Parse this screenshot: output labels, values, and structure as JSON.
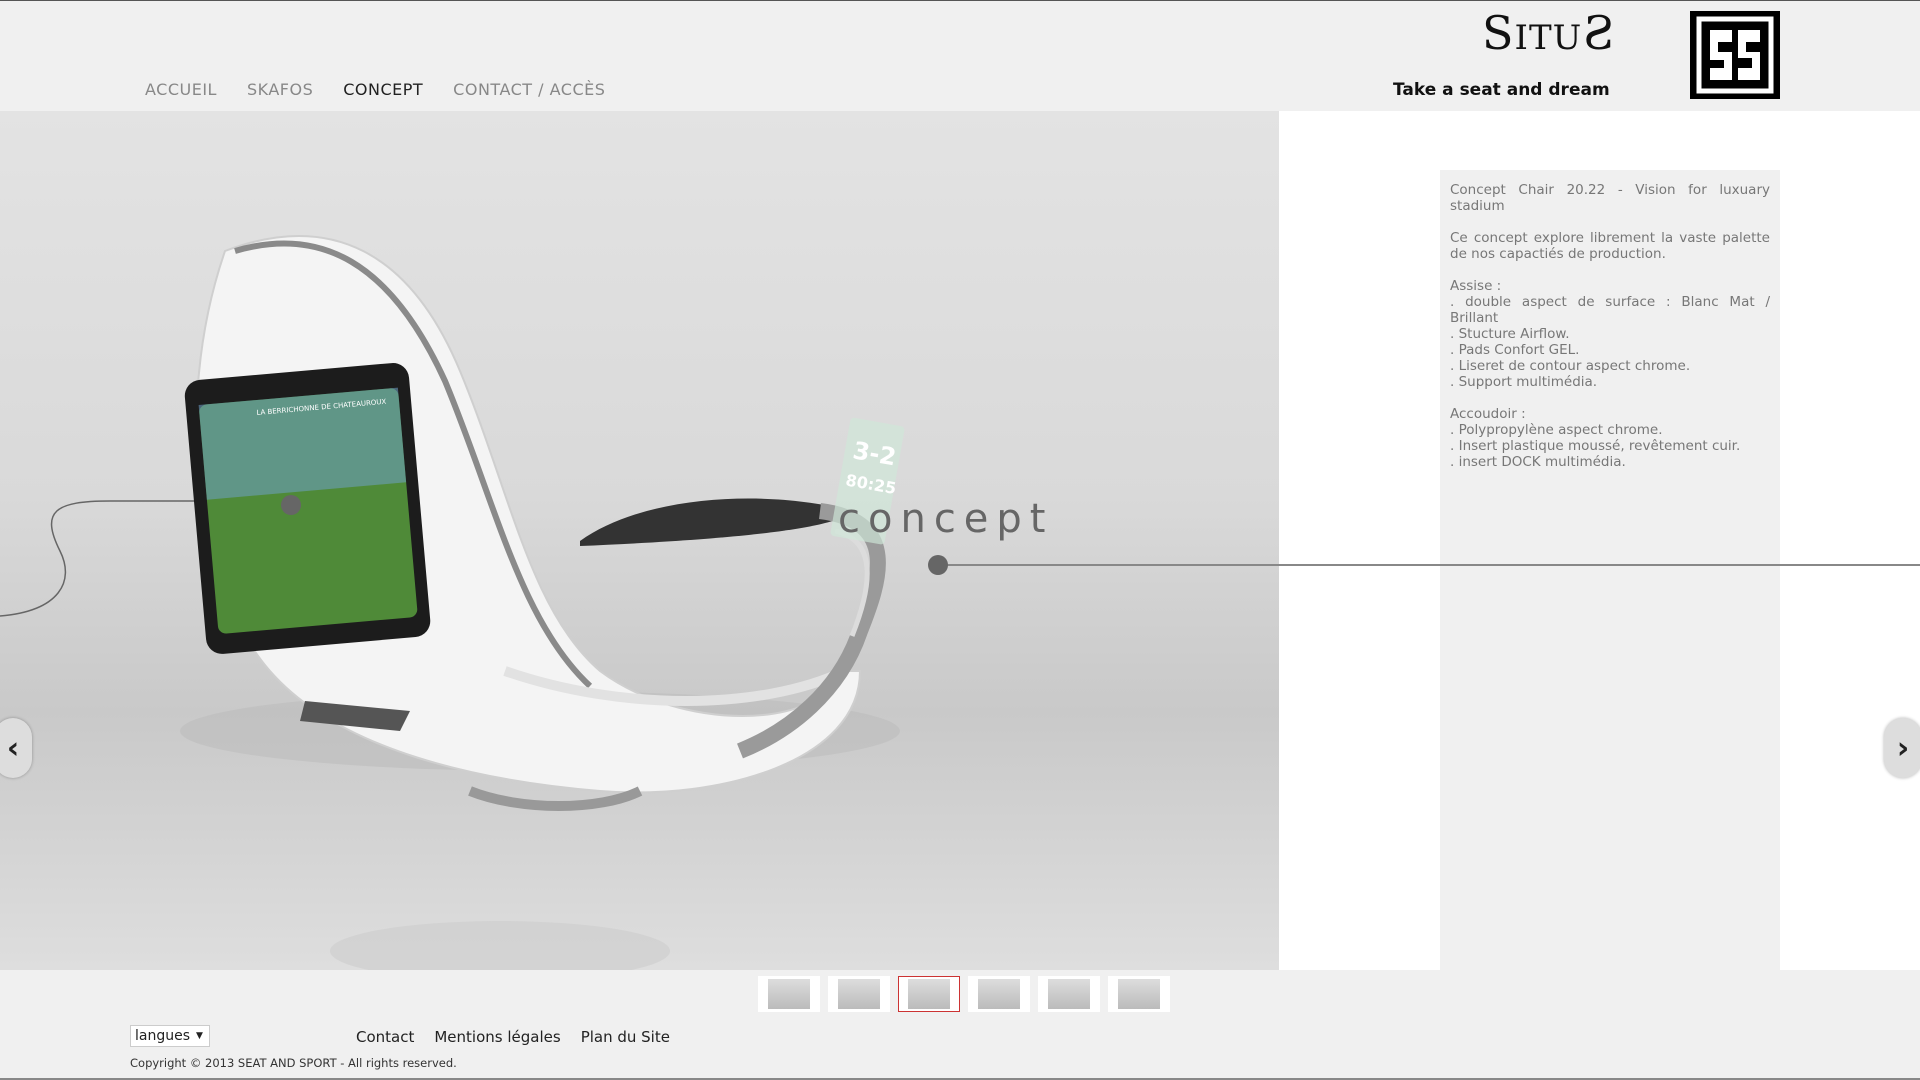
{
  "nav": {
    "items": [
      {
        "label": "ACCUEIL",
        "active": false
      },
      {
        "label": "SKAFOS",
        "active": false
      },
      {
        "label": "CONCEPT",
        "active": true
      },
      {
        "label": "CONTACT / ACCÈS",
        "active": false
      }
    ]
  },
  "brand": {
    "logo_text_first": "S",
    "logo_text_middle": "ITU",
    "logo_text_last": "S",
    "tagline": "Take a seat and dream"
  },
  "slide": {
    "overlay_word": "concept",
    "tablet_title": "LA BERRICHONNE DE CHATEAUROUX",
    "dock_score": "3-2",
    "dock_time": "80:25"
  },
  "info": {
    "title": "Concept Chair 20.22 - Vision for luxuary stadium",
    "intro": "Ce concept explore librement la vaste palette de nos capactiés de production.",
    "assise_heading": "Assise :",
    "assise_items": [
      ". double aspect de surface : Blanc Mat / Brillant",
      ". Stucture Airflow.",
      ". Pads Confort GEL.",
      ". Liseret de contour aspect chrome.",
      ". Support multimédia."
    ],
    "accoudoir_heading": "Accoudoir :",
    "accoudoir_items": [
      ". Polypropylène aspect chrome.",
      ".  Insert plastique moussé, revêtement cuir.",
      ".  insert DOCK multimédia."
    ]
  },
  "carousel": {
    "thumb_count": 6,
    "active_index": 2
  },
  "footer": {
    "language_select": "langues",
    "links": [
      "Contact",
      "Mentions légales",
      "Plan du Site"
    ],
    "copyright": "Copyright © 2013 SEAT AND SPORT - All rights reserved."
  },
  "icons": {
    "prev": "chevron-left-icon",
    "next": "chevron-right-icon",
    "language_caret": "caret-down-icon"
  }
}
